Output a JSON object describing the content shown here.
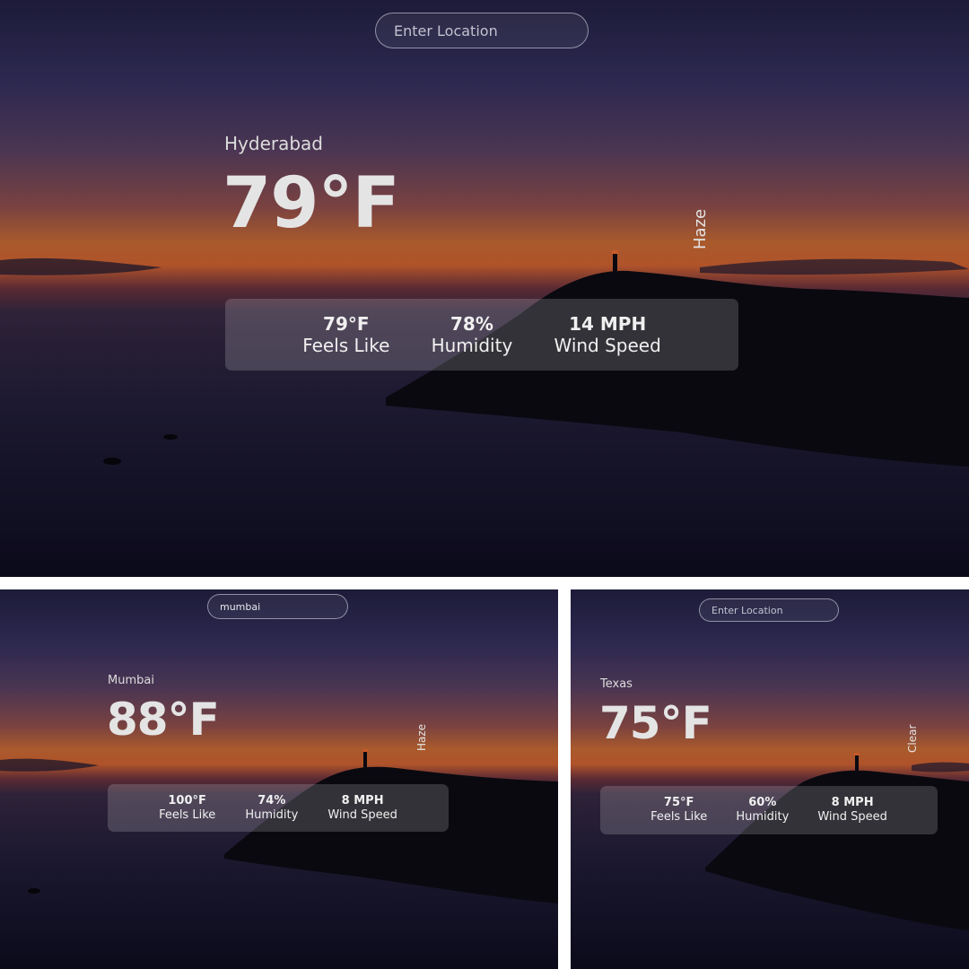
{
  "colors": {
    "sky_top": "#211e3d",
    "sky_glow": "#b85a2a",
    "water": "#1b1830",
    "land": "#08070d",
    "stats_panel": "rgba(255,255,255,0.17)",
    "text": "#e4e4e4"
  },
  "panels": [
    {
      "search": {
        "value": "",
        "placeholder": "Enter Location"
      },
      "city": "Hyderabad",
      "temperature": "79°F",
      "condition": "Haze",
      "stats": [
        {
          "value": "79°F",
          "label": "Feels Like"
        },
        {
          "value": "78%",
          "label": "Humidity"
        },
        {
          "value": "14 MPH",
          "label": "Wind Speed"
        }
      ]
    },
    {
      "search": {
        "value": "mumbai",
        "placeholder": "Enter Location"
      },
      "city": "Mumbai",
      "temperature": "88°F",
      "condition": "Haze",
      "stats": [
        {
          "value": "100°F",
          "label": "Feels Like"
        },
        {
          "value": "74%",
          "label": "Humidity"
        },
        {
          "value": "8 MPH",
          "label": "Wind Speed"
        }
      ]
    },
    {
      "search": {
        "value": "",
        "placeholder": "Enter Location"
      },
      "city": "Texas",
      "temperature": "75°F",
      "condition": "Clear",
      "stats": [
        {
          "value": "75°F",
          "label": "Feels Like"
        },
        {
          "value": "60%",
          "label": "Humidity"
        },
        {
          "value": "8 MPH",
          "label": "Wind Speed"
        }
      ]
    }
  ]
}
